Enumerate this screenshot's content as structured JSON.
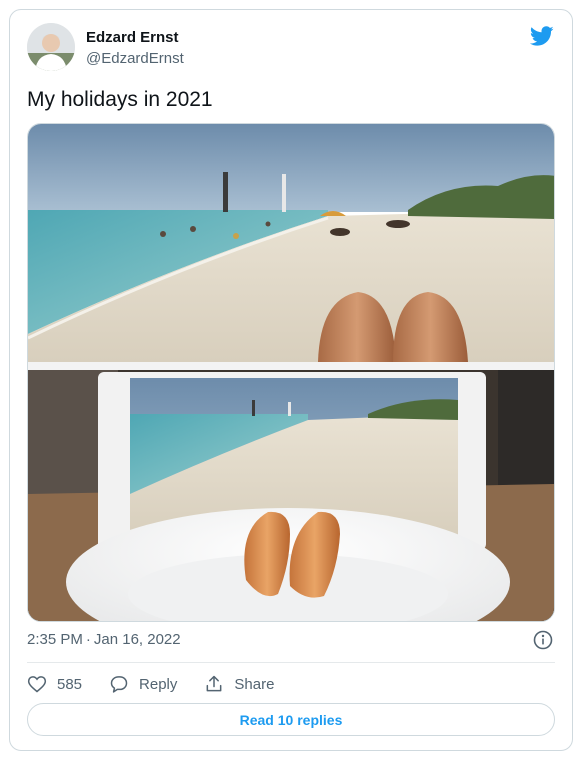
{
  "author": {
    "name": "Edzard Ernst",
    "handle": "@EdzardErnst"
  },
  "tweet": {
    "text": "My holidays in 2021"
  },
  "media": {
    "alt": "Beach photo with knees in the foreground, above a tablet showing the beach photo with two sausages on a plate in the foreground"
  },
  "meta": {
    "time": "2:35 PM",
    "separator": "·",
    "date": "Jan 16, 2022"
  },
  "actions": {
    "likes": "585",
    "reply_label": "Reply",
    "share_label": "Share"
  },
  "read_replies_label": "Read 10 replies",
  "colors": {
    "accent": "#1d9bf0",
    "secondary_text": "#536471",
    "border": "#cfd9de"
  },
  "icons": [
    "twitter-bird-icon",
    "info-icon",
    "heart-icon",
    "reply-icon",
    "share-icon"
  ]
}
